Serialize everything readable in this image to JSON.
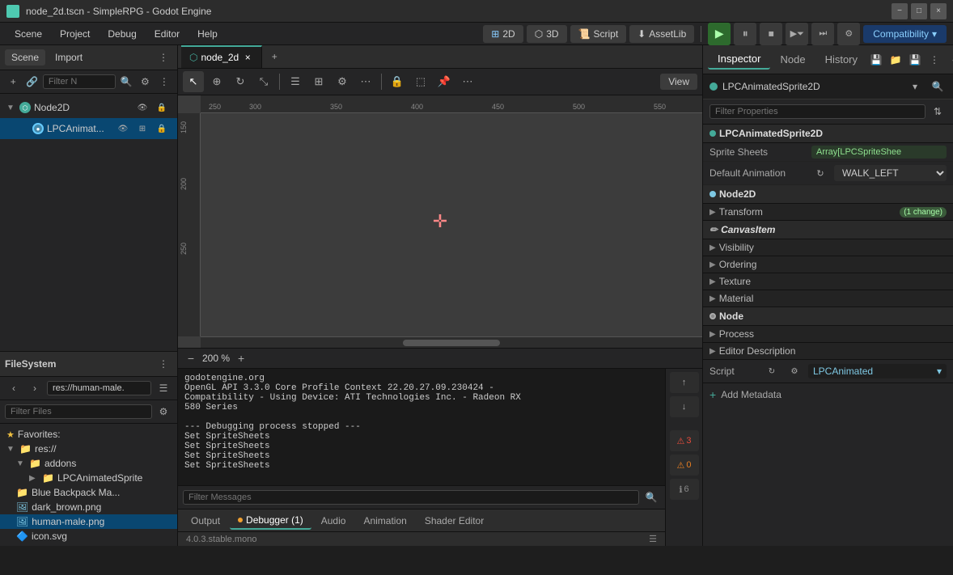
{
  "titlebar": {
    "title": "node_2d.tscn - SimpleRPG - Godot Engine",
    "minimize": "−",
    "maximize": "□",
    "close": "×"
  },
  "menubar": {
    "items": [
      "Scene",
      "Project",
      "Debug",
      "Editor",
      "Help"
    ]
  },
  "toolbar": {
    "btn_2d": "2D",
    "btn_3d": "3D",
    "btn_script": "Script",
    "btn_assetlib": "AssetLib",
    "compat": "Compatibility",
    "compat_arrow": "▾"
  },
  "scene_panel": {
    "tab_scene": "Scene",
    "tab_import": "Import",
    "filter_placeholder": "Filter N",
    "nodes": [
      {
        "label": "Node2D",
        "type": "node2d",
        "indent": 0,
        "expanded": true
      },
      {
        "label": "LPCAnimat...",
        "type": "lpc",
        "indent": 1,
        "expanded": false
      }
    ]
  },
  "filesystem_panel": {
    "title": "FileSystem",
    "path": "res://human-male.",
    "filter_placeholder": "Filter Files",
    "items": [
      {
        "label": "Favorites:",
        "icon": "star",
        "indent": 0
      },
      {
        "label": "res://",
        "icon": "folder",
        "indent": 0,
        "expanded": true
      },
      {
        "label": "addons",
        "icon": "folder",
        "indent": 1,
        "expanded": true
      },
      {
        "label": "LPCAnimatedSprite",
        "icon": "folder",
        "indent": 2,
        "expanded": false
      },
      {
        "label": "Blue Backpack Ma...",
        "icon": "folder",
        "indent": 1
      },
      {
        "label": "dark_brown.png",
        "icon": "file",
        "indent": 1
      },
      {
        "label": "human-male.png",
        "icon": "file",
        "indent": 1,
        "selected": true
      },
      {
        "label": "icon.svg",
        "icon": "file",
        "indent": 1
      }
    ]
  },
  "editor": {
    "tab_name": "node_2d",
    "tab_modified": false,
    "zoom": "200 %",
    "tools": [
      "select",
      "move",
      "rotate",
      "scale",
      "list",
      "snap",
      "grid",
      "more",
      "lock",
      "rect",
      "pin",
      "more2"
    ],
    "view_btn": "View"
  },
  "console": {
    "lines": [
      "godotengine.org",
      "OpenGL API 3.3.0 Core Profile Context 22.20.27.09.230424 -",
      "Compatibility - Using Device: ATI Technologies Inc. - Radeon RX",
      "580 Series",
      "",
      "--- Debugging process stopped ---",
      "Set SpriteSheets",
      "Set SpriteSheets",
      "Set SpriteSheets",
      "Set SpriteSheets"
    ],
    "filter_placeholder": "Filter Messages",
    "tabs": [
      "Output",
      "Debugger (1)",
      "Audio",
      "Animation",
      "Shader Editor"
    ],
    "active_tab": "Debugger (1)",
    "debugger_dot": true,
    "badges": {
      "error": "3",
      "warning": "0",
      "info": "6"
    },
    "version": "4.0.3.stable.mono"
  },
  "inspector": {
    "tabs": [
      "Inspector",
      "Node",
      "History"
    ],
    "active_tab": "Inspector",
    "node_name": "LPCAnimatedSprite2D",
    "filter_placeholder": "Filter Properties",
    "sections": {
      "lpc_header": "LPCAnimatedSprite2D",
      "sprite_sheets_label": "Sprite Sheets",
      "sprite_sheets_value": "Array[LPCSpriteShee",
      "default_anim_label": "Default Animation",
      "default_anim_value": "WALK_LEFT",
      "node2d_header": "Node2D",
      "transform_label": "Transform",
      "transform_change": "(1 change)",
      "canvas_header": "CanvasItem",
      "visibility_label": "Visibility",
      "ordering_label": "Ordering",
      "texture_label": "Texture",
      "material_label": "Material",
      "node_header": "Node",
      "process_label": "Process",
      "editor_desc_label": "Editor Description",
      "script_label": "Script",
      "script_value": "LPCAnimated",
      "add_metadata": "Add Metadata"
    }
  }
}
